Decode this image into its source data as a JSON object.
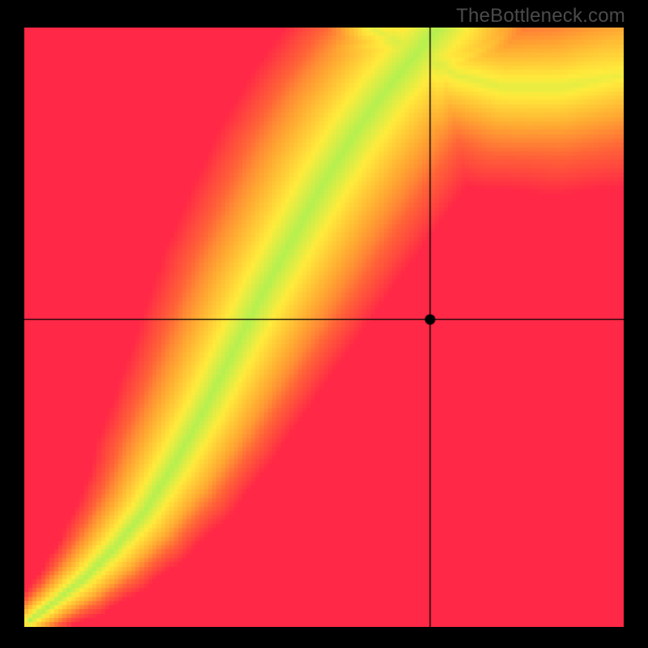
{
  "watermark": "TheBottleneck.com",
  "chart_data": {
    "type": "heatmap",
    "title": "",
    "xlabel": "",
    "ylabel": "",
    "xlim": [
      0,
      1
    ],
    "ylim": [
      0,
      1
    ],
    "grid": false,
    "marker": {
      "x": 0.677,
      "y": 0.513
    },
    "crosshair": {
      "x": 0.677,
      "y": 0.513
    },
    "ridge": {
      "description": "Green optimal band as (x, y) fractions from lower-left, half-width fraction per point",
      "points": [
        {
          "x": 0.01,
          "y": 0.01,
          "w": 0.008
        },
        {
          "x": 0.05,
          "y": 0.04,
          "w": 0.01
        },
        {
          "x": 0.1,
          "y": 0.08,
          "w": 0.014
        },
        {
          "x": 0.15,
          "y": 0.13,
          "w": 0.018
        },
        {
          "x": 0.2,
          "y": 0.19,
          "w": 0.022
        },
        {
          "x": 0.25,
          "y": 0.27,
          "w": 0.027
        },
        {
          "x": 0.3,
          "y": 0.36,
          "w": 0.03
        },
        {
          "x": 0.35,
          "y": 0.46,
          "w": 0.033
        },
        {
          "x": 0.4,
          "y": 0.56,
          "w": 0.036
        },
        {
          "x": 0.45,
          "y": 0.65,
          "w": 0.038
        },
        {
          "x": 0.5,
          "y": 0.74,
          "w": 0.04
        },
        {
          "x": 0.55,
          "y": 0.82,
          "w": 0.041
        },
        {
          "x": 0.6,
          "y": 0.89,
          "w": 0.041
        },
        {
          "x": 0.65,
          "y": 0.95,
          "w": 0.042
        },
        {
          "x": 0.7,
          "y": 1.01,
          "w": 0.042
        }
      ]
    },
    "secondary_band": {
      "description": "Yellow upper-right wedge band originating near top",
      "points": [
        {
          "x": 0.58,
          "y": 1.0,
          "w": 0.035
        },
        {
          "x": 0.65,
          "y": 0.96,
          "w": 0.04
        },
        {
          "x": 0.72,
          "y": 0.92,
          "w": 0.045
        },
        {
          "x": 0.8,
          "y": 0.9,
          "w": 0.05
        },
        {
          "x": 0.9,
          "y": 0.9,
          "w": 0.055
        },
        {
          "x": 1.0,
          "y": 0.92,
          "w": 0.06
        }
      ]
    },
    "colormap": {
      "stops": [
        {
          "t": 0.0,
          "r": 15,
          "g": 230,
          "b": 150
        },
        {
          "t": 0.12,
          "r": 180,
          "g": 240,
          "b": 80
        },
        {
          "t": 0.28,
          "r": 255,
          "g": 235,
          "b": 60
        },
        {
          "t": 0.5,
          "r": 255,
          "g": 170,
          "b": 50
        },
        {
          "t": 0.72,
          "r": 255,
          "g": 100,
          "b": 55
        },
        {
          "t": 1.0,
          "r": 255,
          "g": 40,
          "b": 70
        }
      ]
    },
    "resolution": 140
  }
}
